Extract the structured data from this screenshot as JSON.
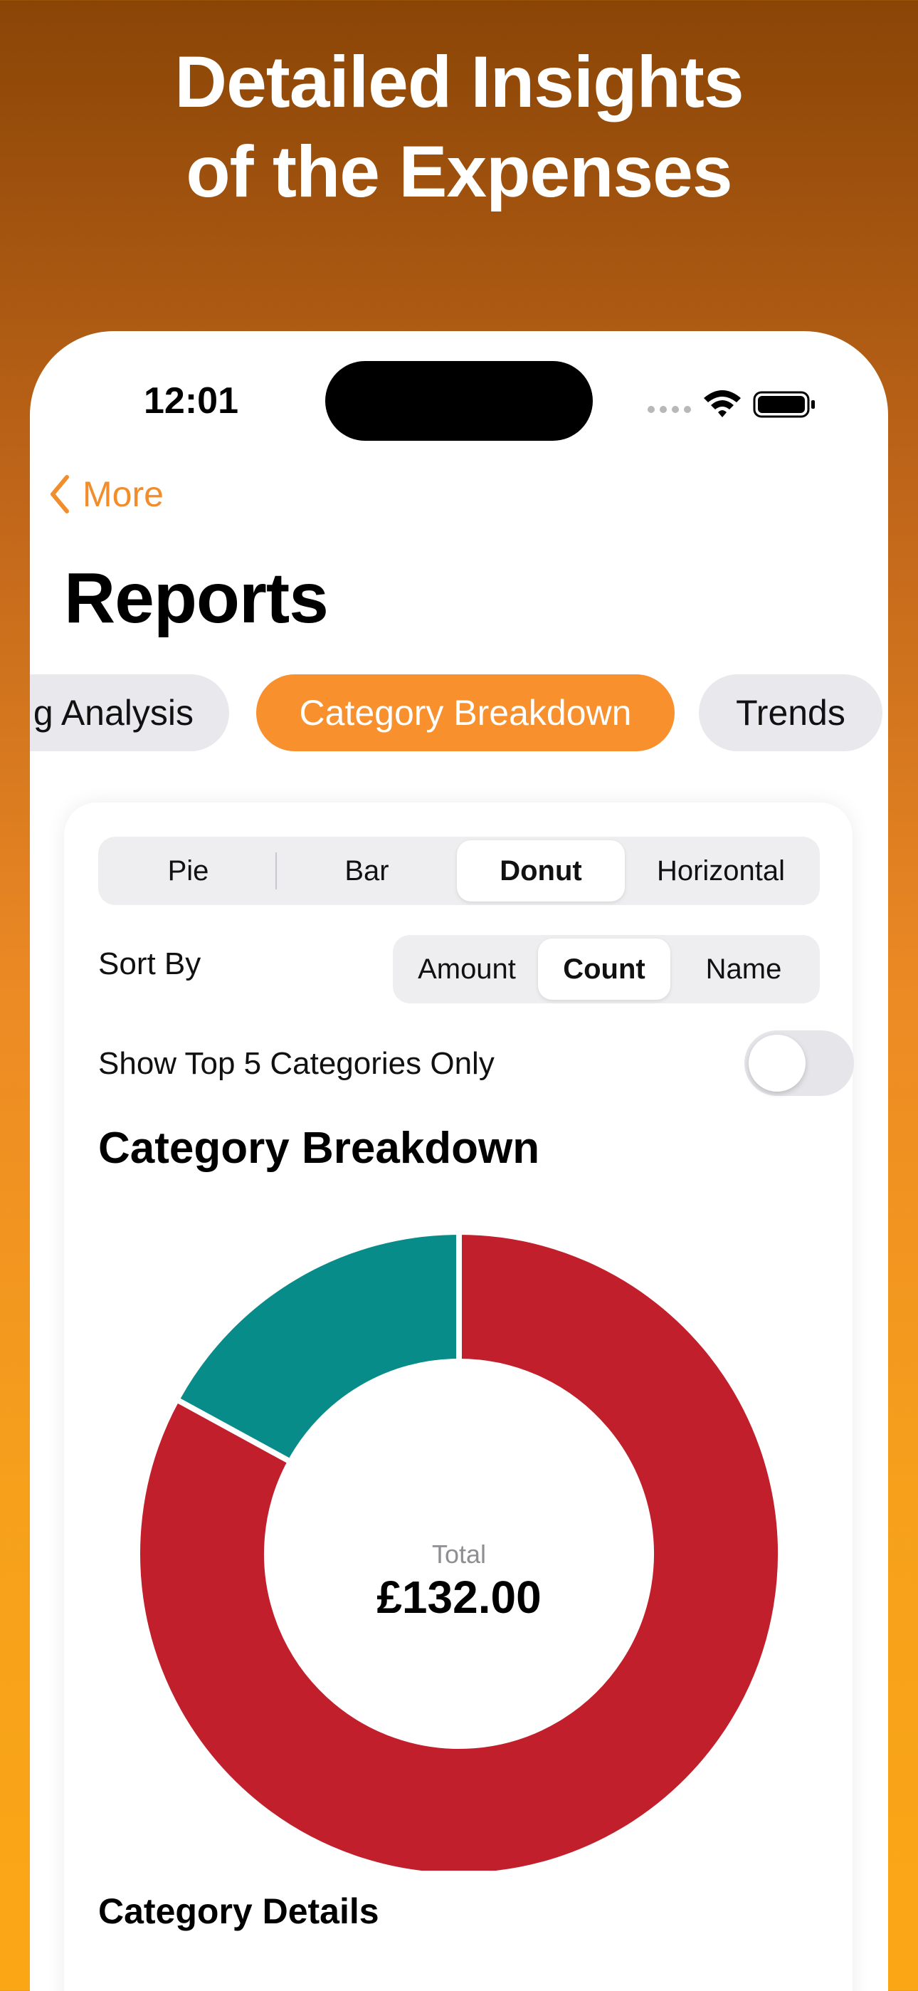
{
  "promo": {
    "headline_line1": "Detailed Insights",
    "headline_line2": "of the Expenses"
  },
  "status_bar": {
    "time": "12:01",
    "icons": [
      "signal-dots-icon",
      "wifi-icon",
      "battery-icon"
    ]
  },
  "nav": {
    "back_label": "More",
    "title": "Reports",
    "accent_color": "#f28d2b"
  },
  "report_tabs": [
    {
      "label": "g Analysis",
      "selected": false
    },
    {
      "label": "Category Breakdown",
      "selected": true
    },
    {
      "label": "Trends",
      "selected": false
    }
  ],
  "chart_type_picker": {
    "options": [
      "Pie",
      "Bar",
      "Donut",
      "Horizontal"
    ],
    "selected": "Donut"
  },
  "sort": {
    "label": "Sort By",
    "options": [
      "Amount",
      "Count",
      "Name"
    ],
    "selected": "Count"
  },
  "top5_toggle": {
    "label": "Show Top 5 Categories Only",
    "on": false
  },
  "section_title": "Category Breakdown",
  "chart_data": {
    "type": "pie",
    "style": "donut",
    "title": "Category Breakdown",
    "center_label": "Total",
    "center_value": "£132.00",
    "slices": [
      {
        "value": 109.5,
        "color": "#c11f2b"
      },
      {
        "value": 22.5,
        "color": "#088c8a"
      }
    ]
  },
  "details_title": "Category Details"
}
